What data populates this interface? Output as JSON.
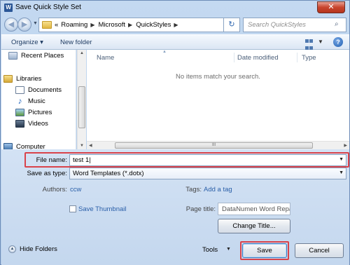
{
  "window": {
    "app_icon": "W",
    "title": "Save Quick Style Set",
    "close_icon": "close-icon",
    "close_glyph": "✕"
  },
  "address": {
    "back_glyph": "◀",
    "forward_glyph": "▶",
    "crumbs": [
      "Roaming",
      "Microsoft",
      "QuickStyles"
    ],
    "prefix": "«",
    "sep_glyph": "▶",
    "refresh_glyph": "↻",
    "search_placeholder": "Search QuickStyles",
    "search_glyph": "⌕"
  },
  "toolbar": {
    "organize_label": "Organize ▾",
    "new_folder_label": "New folder",
    "help_glyph": "?"
  },
  "nav": {
    "items": [
      {
        "label": "Recent Places",
        "icon": "recent-places-icon"
      },
      {
        "label": "Libraries",
        "icon": "libraries-icon"
      },
      {
        "label": "Documents",
        "icon": "documents-icon"
      },
      {
        "label": "Music",
        "icon": "music-icon"
      },
      {
        "label": "Pictures",
        "icon": "pictures-icon"
      },
      {
        "label": "Videos",
        "icon": "videos-icon"
      },
      {
        "label": "Computer",
        "icon": "computer-icon"
      }
    ]
  },
  "filelist": {
    "columns": [
      "Name",
      "Date modified",
      "Type"
    ],
    "empty_message": "No items match your search.",
    "scroll_grip": "III"
  },
  "form": {
    "file_name_label": "File name:",
    "file_name_value": "test 1",
    "save_as_type_label": "Save as type:",
    "save_as_type_value": "Word Templates (*.dotx)",
    "authors_label": "Authors:",
    "authors_value": "ccw",
    "tags_label": "Tags:",
    "tags_value": "Add a tag",
    "save_thumbnail_label": "Save Thumbnail",
    "page_title_label": "Page title:",
    "page_title_value": "DataNumen Word Repa",
    "change_title_label": "Change Title...",
    "hide_folders_label": "Hide Folders",
    "tools_label": "Tools",
    "save_label": "Save",
    "cancel_label": "Cancel"
  },
  "colors": {
    "highlight": "#d9434b",
    "link": "#2a5fa8"
  }
}
